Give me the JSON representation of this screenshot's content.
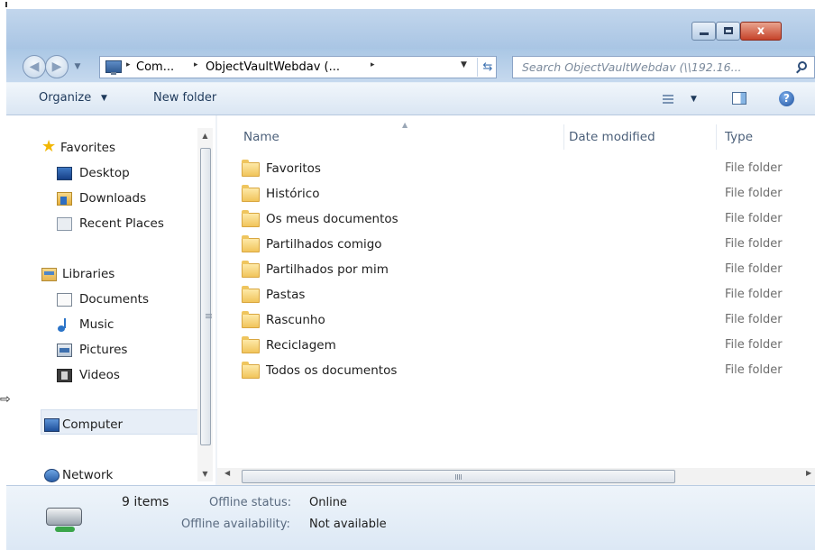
{
  "window": {
    "close_glyph": "x"
  },
  "address": {
    "crumbs": [
      "Com...",
      "ObjectVaultWebdav (..."
    ],
    "separator": "▸",
    "dropdown": "▼"
  },
  "search": {
    "placeholder": "Search ObjectVaultWebdav (\\\\192.16..."
  },
  "commandbar": {
    "organize": "Organize",
    "organize_caret": "▼",
    "new_folder": "New folder",
    "views_caret": "▼",
    "help": "?"
  },
  "navpane": {
    "favorites": {
      "label": "Favorites",
      "items": [
        "Desktop",
        "Downloads",
        "Recent Places"
      ]
    },
    "libraries": {
      "label": "Libraries",
      "items": [
        "Documents",
        "Music",
        "Pictures",
        "Videos"
      ]
    },
    "computer": "Computer",
    "network": "Network"
  },
  "filelist": {
    "columns": [
      "Name",
      "Date modified",
      "Type"
    ],
    "rows": [
      {
        "name": "Favoritos",
        "type": "File folder"
      },
      {
        "name": "Histórico",
        "type": "File folder"
      },
      {
        "name": "Os meus documentos",
        "type": "File folder"
      },
      {
        "name": "Partilhados comigo",
        "type": "File folder"
      },
      {
        "name": "Partilhados por mim",
        "type": "File folder"
      },
      {
        "name": "Pastas",
        "type": "File folder"
      },
      {
        "name": "Rascunho",
        "type": "File folder"
      },
      {
        "name": "Reciclagem",
        "type": "File folder"
      },
      {
        "name": "Todos os documentos",
        "type": "File folder"
      }
    ]
  },
  "details": {
    "item_count": "9 items",
    "offline_status_label": "Offline status:",
    "offline_status_value": "Online",
    "offline_availability_label": "Offline availability:",
    "offline_availability_value": "Not available"
  },
  "icons": {
    "titlebar": [
      "minimize-icon",
      "maximize-icon",
      "close-icon"
    ],
    "nav": [
      "back-arrow-icon",
      "forward-arrow-icon",
      "computer-network-icon",
      "refresh-icon",
      "search-icon"
    ],
    "toolbar": [
      "views-icon",
      "preview-pane-icon",
      "help-icon"
    ],
    "tree": [
      "star-icon",
      "desktop-icon",
      "downloads-icon",
      "recent-places-icon",
      "libraries-icon",
      "documents-icon",
      "music-icon",
      "pictures-icon",
      "videos-icon",
      "computer-icon",
      "network-icon"
    ],
    "content": [
      "folder-icon",
      "network-drive-icon"
    ]
  },
  "colors": {
    "accent": "#1e395b",
    "titlebar": "#b5cfe9",
    "close_button": "#c6432a",
    "folder": "#f1c45b"
  }
}
